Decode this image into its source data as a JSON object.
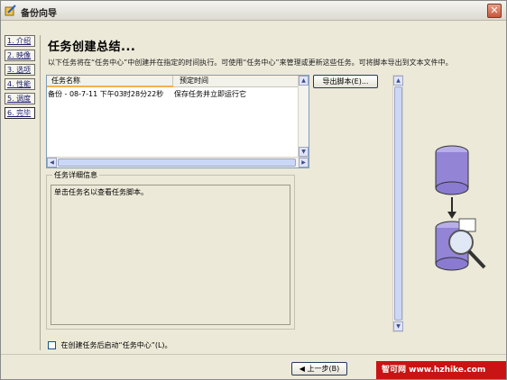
{
  "window": {
    "title": "备份向导",
    "close_label": "✕"
  },
  "steps": [
    {
      "label": "1. 介绍"
    },
    {
      "label": "2. 映像"
    },
    {
      "label": "3. 选项"
    },
    {
      "label": "4. 性能"
    },
    {
      "label": "5. 调度"
    },
    {
      "label": "6. 完毕"
    }
  ],
  "main": {
    "heading": "任务创建总结...",
    "description": "以下任务将在“任务中心”中创建并在指定的时间执行。可使用“任务中心”来管理或更新这些任务。可将脚本导出到文本文件中。",
    "table": {
      "columns": [
        "任务名称",
        "预定时间"
      ],
      "rows": [
        {
          "name": "备份 - 08-7-11 下午03时28分22秒",
          "time": "保存任务并立即运行它"
        }
      ]
    },
    "export_button": "导出脚本(E)...",
    "details": {
      "legend": "任务详细信息",
      "text": "单击任务名以查看任务脚本。"
    },
    "auto_run_label": "在创建任务后启动“任务中心”(L)。"
  },
  "footer": {
    "back_button": "◀ 上一步(B)"
  },
  "watermark": "智可网 www.hzhike.com"
}
